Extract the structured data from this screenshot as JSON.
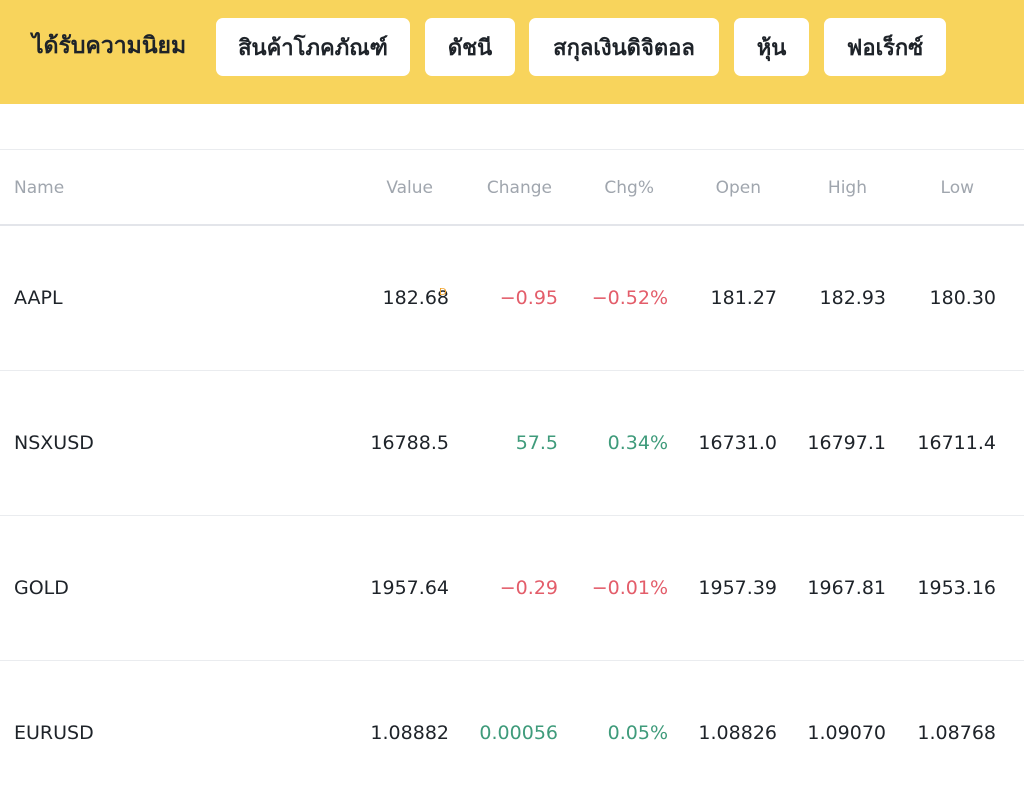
{
  "topbar": {
    "title": "ได้รับความนิยม",
    "tabs": [
      "สินค้าโภคภัณฑ์",
      "ดัชนี",
      "สกุลเงินดิจิตอล",
      "หุ้น",
      "ฟอเร็กซ์"
    ]
  },
  "table": {
    "columns": [
      "Name",
      "Value",
      "Change",
      "Chg%",
      "Open",
      "High",
      "Low"
    ],
    "rows": [
      {
        "name": "AAPL",
        "value": "182.68",
        "change": "−0.95",
        "chgpct": "−0.52%",
        "open": "181.27",
        "high": "182.93",
        "low": "180.30",
        "trend": "negative",
        "value_badge": "D"
      },
      {
        "name": "NSXUSD",
        "value": "16788.5",
        "change": "57.5",
        "chgpct": "0.34%",
        "open": "16731.0",
        "high": "16797.1",
        "low": "16711.4",
        "trend": "positive"
      },
      {
        "name": "GOLD",
        "value": "1957.64",
        "change": "−0.29",
        "chgpct": "−0.01%",
        "open": "1957.39",
        "high": "1967.81",
        "low": "1953.16",
        "trend": "negative"
      },
      {
        "name": "EURUSD",
        "value": "1.08882",
        "change": "0.00056",
        "chgpct": "0.05%",
        "open": "1.08826",
        "high": "1.09070",
        "low": "1.08768",
        "trend": "positive"
      }
    ]
  },
  "colors": {
    "accent": "#f8d45c",
    "negative": "#e35d6a",
    "positive": "#3f9b7b",
    "badge": "#f0a12a"
  }
}
